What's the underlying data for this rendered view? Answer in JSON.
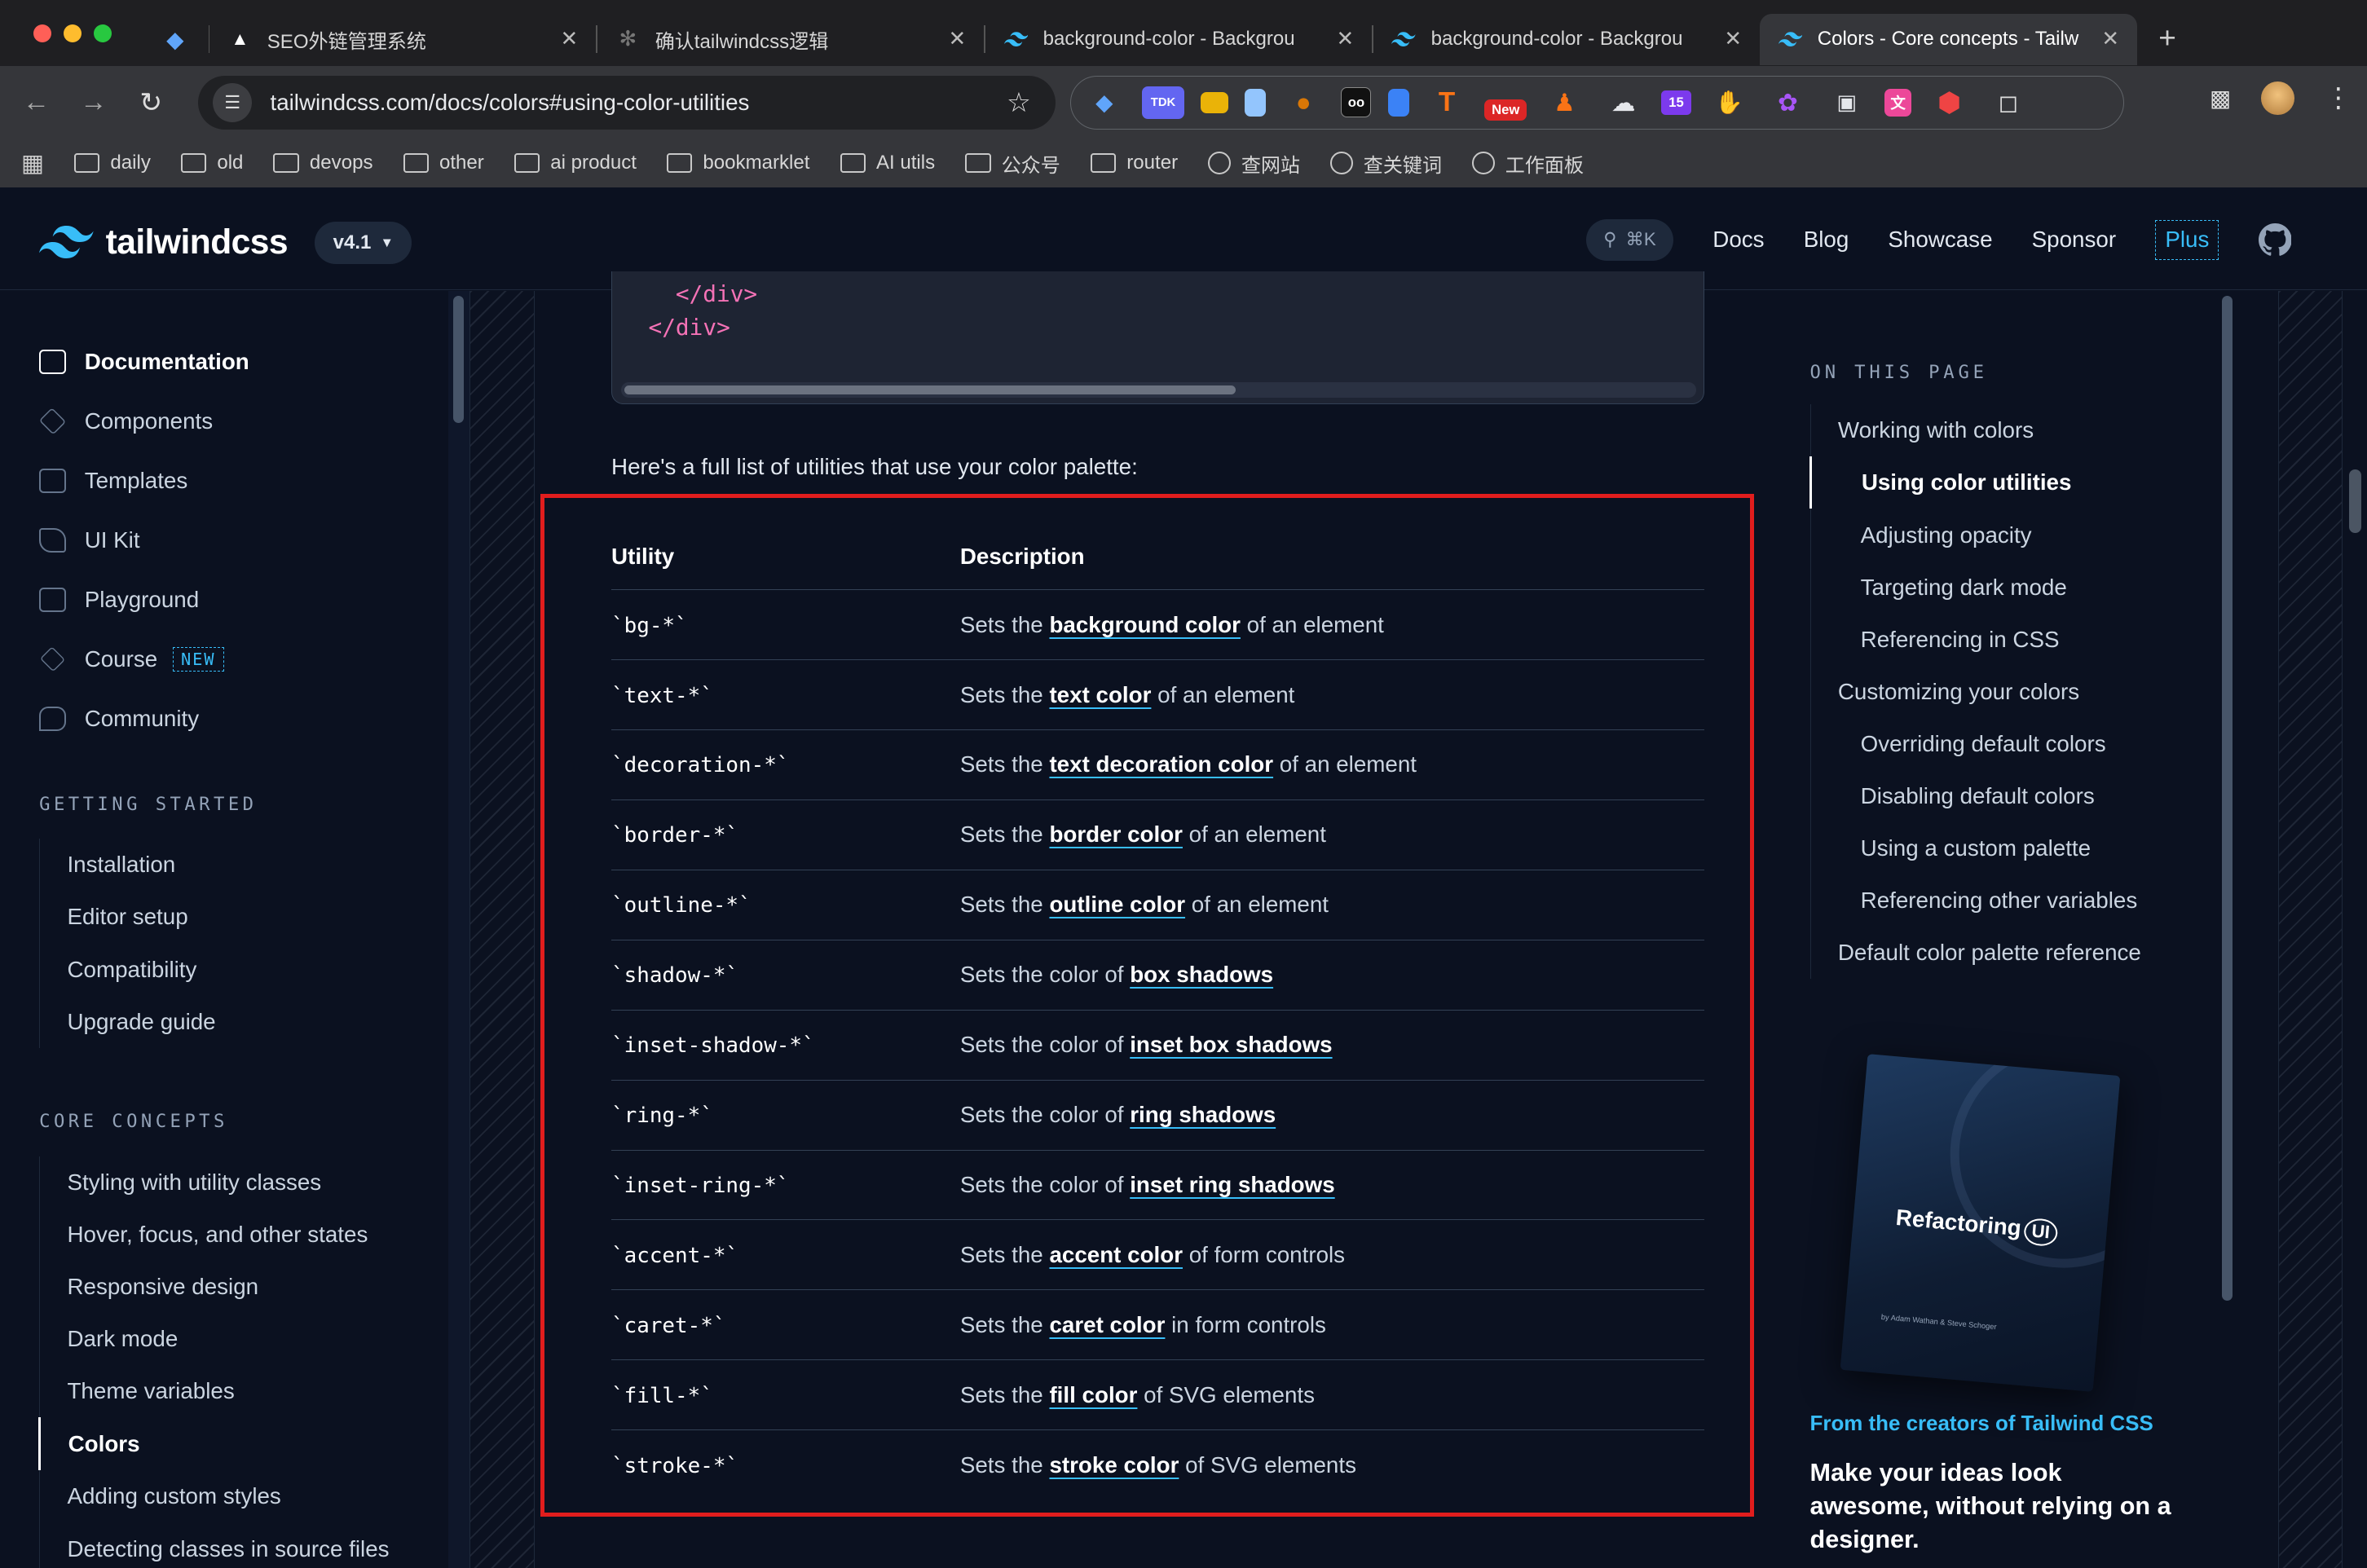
{
  "browser": {
    "tabs": [
      {
        "title": "",
        "icon": "diamond-icon",
        "pinned": true
      },
      {
        "title": "SEO外链管理系统",
        "icon": "triangle-icon"
      },
      {
        "title": "确认tailwindcss逻辑",
        "icon": "openai-icon"
      },
      {
        "title": "background-color - Backgrou",
        "icon": "tailwind-icon"
      },
      {
        "title": "background-color - Backgrou",
        "icon": "tailwind-icon"
      },
      {
        "title": "Colors - Core concepts - Tailw",
        "icon": "tailwind-icon",
        "active": true
      }
    ],
    "url": "tailwindcss.com/docs/colors#using-color-utilities",
    "extensions": [
      "TDK",
      "",
      "",
      "",
      "",
      "",
      "",
      "New",
      "",
      "",
      "15",
      "",
      "",
      "",
      "",
      "",
      ""
    ],
    "bookmarks": [
      {
        "label": "daily",
        "type": "folder"
      },
      {
        "label": "old",
        "type": "folder"
      },
      {
        "label": "devops",
        "type": "folder"
      },
      {
        "label": "other",
        "type": "folder"
      },
      {
        "label": "ai product",
        "type": "folder"
      },
      {
        "label": "bookmarklet",
        "type": "folder"
      },
      {
        "label": "AI utils",
        "type": "folder"
      },
      {
        "label": "公众号",
        "type": "folder"
      },
      {
        "label": "router",
        "type": "folder"
      },
      {
        "label": "查网站",
        "type": "globe"
      },
      {
        "label": "查关键词",
        "type": "globe"
      },
      {
        "label": "工作面板",
        "type": "globe"
      }
    ]
  },
  "site": {
    "logo": "tailwindcss",
    "version": "v4.1",
    "search_hint": "⌘K",
    "nav": [
      "Docs",
      "Blog",
      "Showcase",
      "Sponsor",
      "Plus"
    ],
    "accent": "#38bdf8"
  },
  "sidebar": {
    "main": [
      {
        "label": "Documentation",
        "icon": "book-icon",
        "active": true
      },
      {
        "label": "Components",
        "icon": "layers-icon"
      },
      {
        "label": "Templates",
        "icon": "template-icon"
      },
      {
        "label": "UI Kit",
        "icon": "cube-icon"
      },
      {
        "label": "Playground",
        "icon": "code-icon"
      },
      {
        "label": "Course",
        "icon": "graduation-icon",
        "badge": "NEW"
      },
      {
        "label": "Community",
        "icon": "chat-icon"
      }
    ],
    "sections": [
      {
        "title": "GETTING STARTED",
        "items": [
          "Installation",
          "Editor setup",
          "Compatibility",
          "Upgrade guide"
        ]
      },
      {
        "title": "CORE CONCEPTS",
        "items": [
          "Styling with utility classes",
          "Hover, focus, and other states",
          "Responsive design",
          "Dark mode",
          "Theme variables",
          "Colors",
          "Adding custom styles",
          "Detecting classes in source files"
        ],
        "active": "Colors"
      }
    ]
  },
  "content": {
    "code_lines": [
      "</div>",
      "</div>"
    ],
    "intro": "Here's a full list of utilities that use your color palette:",
    "table": {
      "headers": [
        "Utility",
        "Description"
      ],
      "rows": [
        {
          "utility": "`bg-*`",
          "pre": "Sets the ",
          "link": "background color",
          "post": " of an element"
        },
        {
          "utility": "`text-*`",
          "pre": "Sets the ",
          "link": "text color",
          "post": " of an element"
        },
        {
          "utility": "`decoration-*`",
          "pre": "Sets the ",
          "link": "text decoration color",
          "post": " of an element"
        },
        {
          "utility": "`border-*`",
          "pre": "Sets the ",
          "link": "border color",
          "post": " of an element"
        },
        {
          "utility": "`outline-*`",
          "pre": "Sets the ",
          "link": "outline color",
          "post": " of an element"
        },
        {
          "utility": "`shadow-*`",
          "pre": "Sets the color of ",
          "link": "box shadows",
          "post": ""
        },
        {
          "utility": "`inset-shadow-*`",
          "pre": "Sets the color of ",
          "link": "inset box shadows",
          "post": ""
        },
        {
          "utility": "`ring-*`",
          "pre": "Sets the color of ",
          "link": "ring shadows",
          "post": ""
        },
        {
          "utility": "`inset-ring-*`",
          "pre": "Sets the color of ",
          "link": "inset ring shadows",
          "post": ""
        },
        {
          "utility": "`accent-*`",
          "pre": "Sets the ",
          "link": "accent color",
          "post": " of form controls"
        },
        {
          "utility": "`caret-*`",
          "pre": "Sets the ",
          "link": "caret color",
          "post": " in form controls"
        },
        {
          "utility": "`fill-*`",
          "pre": "Sets the ",
          "link": "fill color",
          "post": " of SVG elements"
        },
        {
          "utility": "`stroke-*`",
          "pre": "Sets the ",
          "link": "stroke color",
          "post": " of SVG elements"
        }
      ]
    },
    "highlight_color": "#e11d1d"
  },
  "toc": {
    "title": "ON THIS PAGE",
    "items": [
      {
        "label": "Working with colors",
        "level": 1
      },
      {
        "label": "Using color utilities",
        "level": 2,
        "active": true
      },
      {
        "label": "Adjusting opacity",
        "level": 2
      },
      {
        "label": "Targeting dark mode",
        "level": 2
      },
      {
        "label": "Referencing in CSS",
        "level": 2
      },
      {
        "label": "Customizing your colors",
        "level": 1
      },
      {
        "label": "Overriding default colors",
        "level": 2
      },
      {
        "label": "Disabling default colors",
        "level": 2
      },
      {
        "label": "Using a custom palette",
        "level": 2
      },
      {
        "label": "Referencing other variables",
        "level": 2
      },
      {
        "label": "Default color palette reference",
        "level": 1
      }
    ]
  },
  "promo": {
    "book_title": "Refactoring",
    "book_badge": "UI",
    "book_authors": "by Adam Wathan & Steve Schoger",
    "kicker": "From the creators of Tailwind CSS",
    "headline": "Make your ideas look awesome, without relying on a designer."
  }
}
